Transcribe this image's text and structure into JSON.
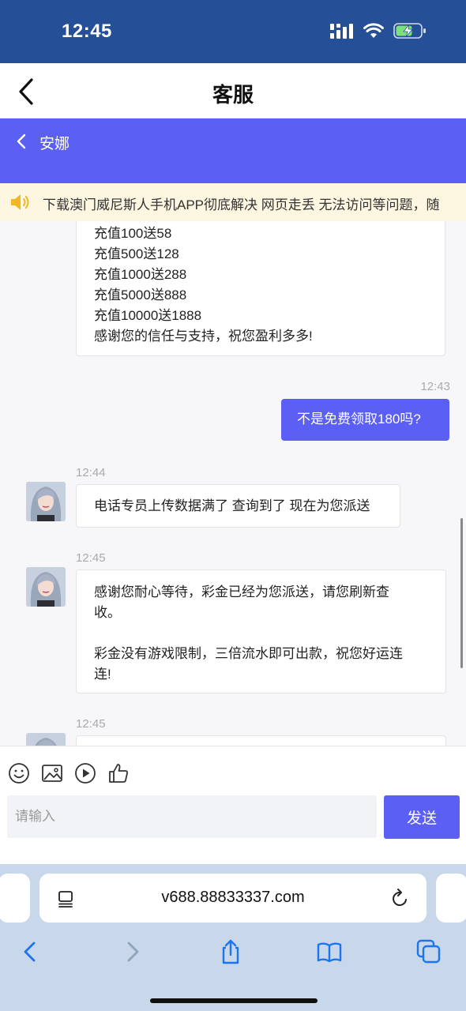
{
  "status_bar": {
    "time": "12:45"
  },
  "header": {
    "title": "客服"
  },
  "chat_header": {
    "agent_name": "安娜"
  },
  "notice": {
    "text": "下载澳门威尼斯人手机APP彻底解决 网页走丢 无法访问等问题，随"
  },
  "messages": {
    "msg1": {
      "lines": [
        "充值100送58",
        "充值500送128",
        "充值1000送288",
        "充值5000送888",
        "充值10000送1888",
        "感谢您的信任与支持，祝您盈利多多!"
      ]
    },
    "msg2": {
      "time": "12:43",
      "text": "不是免费领取180吗?"
    },
    "msg3": {
      "time": "12:44",
      "text": "电话专员上传数据满了 查询到了 现在为您派送"
    },
    "msg4": {
      "time": "12:45",
      "lines": [
        "感谢您耐心等待，彩金已经为您派送，请您刷新查",
        "收。",
        "彩金没有游戏限制，三倍流水即可出款，祝您好运连",
        "连!"
      ]
    },
    "msg5": {
      "time": "12:45"
    }
  },
  "input": {
    "placeholder": "请输入",
    "value": "",
    "send_label": "发送"
  },
  "browser": {
    "url": "v688.88833337.com"
  },
  "colors": {
    "accent": "#5b5ff4",
    "status_bar": "#254f96",
    "notice_bg": "#fdf6e0",
    "chat_bg": "#f7f7fa"
  },
  "icons": {
    "status": [
      "signal-icon",
      "wifi-icon",
      "battery-charging-icon"
    ],
    "tools": [
      "emoji-icon",
      "image-icon",
      "video-icon",
      "thumbs-up-icon"
    ],
    "browser": [
      "tabs-list-icon",
      "reload-icon",
      "back-arrow-icon",
      "forward-arrow-icon",
      "share-icon",
      "bookmarks-icon",
      "tabs-icon"
    ]
  }
}
